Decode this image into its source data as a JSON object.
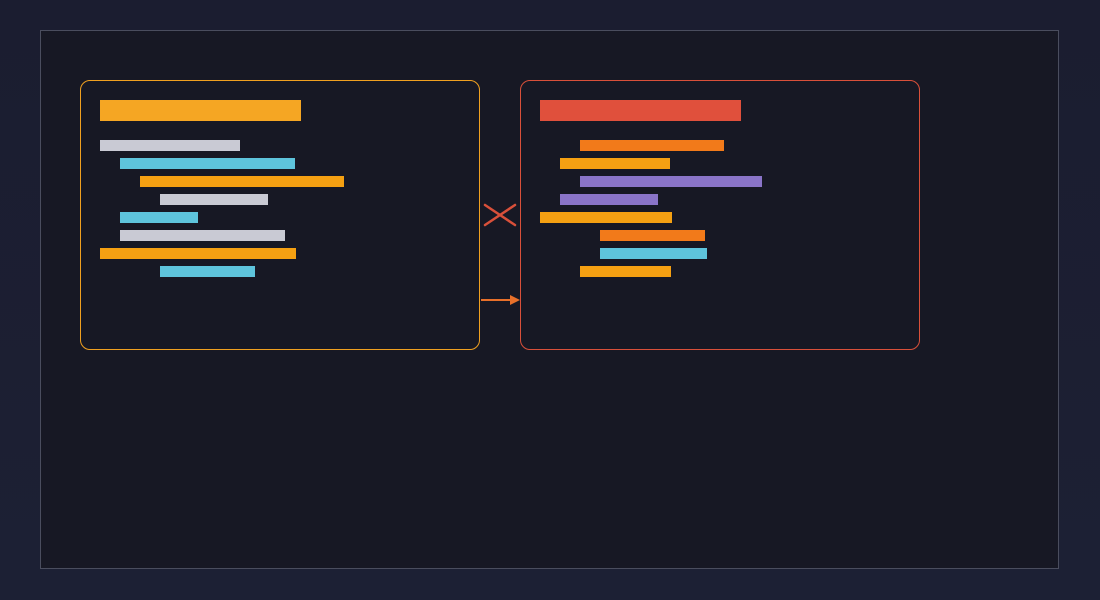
{
  "colors": {
    "background": "#1b1d30",
    "canvas": "#171824",
    "canvas_border": "#4a4d5e",
    "left_panel_border": "#f0a020",
    "right_panel_border": "#d9503a",
    "connector": "#e8702a"
  },
  "left_panel": {
    "title_color": "#f5a623",
    "lines": [
      {
        "indent": 0,
        "length": 140,
        "color": "#c9cad4"
      },
      {
        "indent": 1,
        "length": 175,
        "color": "#5ec4dc"
      },
      {
        "indent": 2,
        "length": 204,
        "color": "#f5a012"
      },
      {
        "indent": 3,
        "length": 108,
        "color": "#c9cad4"
      },
      {
        "indent": 1,
        "length": 78,
        "color": "#5ec4dc"
      },
      {
        "indent": 1,
        "length": 165,
        "color": "#c9cad4"
      },
      {
        "indent": 0,
        "length": 196,
        "color": "#f5a012"
      },
      {
        "indent": 3,
        "length": 95,
        "color": "#5ec4dc"
      }
    ]
  },
  "right_panel": {
    "title_color": "#e0503c",
    "lines": [
      {
        "indent": 2,
        "length": 144,
        "color": "#f27a1a"
      },
      {
        "indent": 1,
        "length": 110,
        "color": "#f5a012"
      },
      {
        "indent": 2,
        "length": 182,
        "color": "#8a74c8"
      },
      {
        "indent": 1,
        "length": 98,
        "color": "#8a74c8"
      },
      {
        "indent": 0,
        "length": 132,
        "color": "#f5a012"
      },
      {
        "indent": 3,
        "length": 105,
        "color": "#f27a1a"
      },
      {
        "indent": 3,
        "length": 107,
        "color": "#5ec4dc"
      },
      {
        "indent": 2,
        "length": 91,
        "color": "#f5a012"
      }
    ]
  },
  "connectors": {
    "cross_icon": "close-icon",
    "arrow_icon": "arrow-right-icon"
  }
}
